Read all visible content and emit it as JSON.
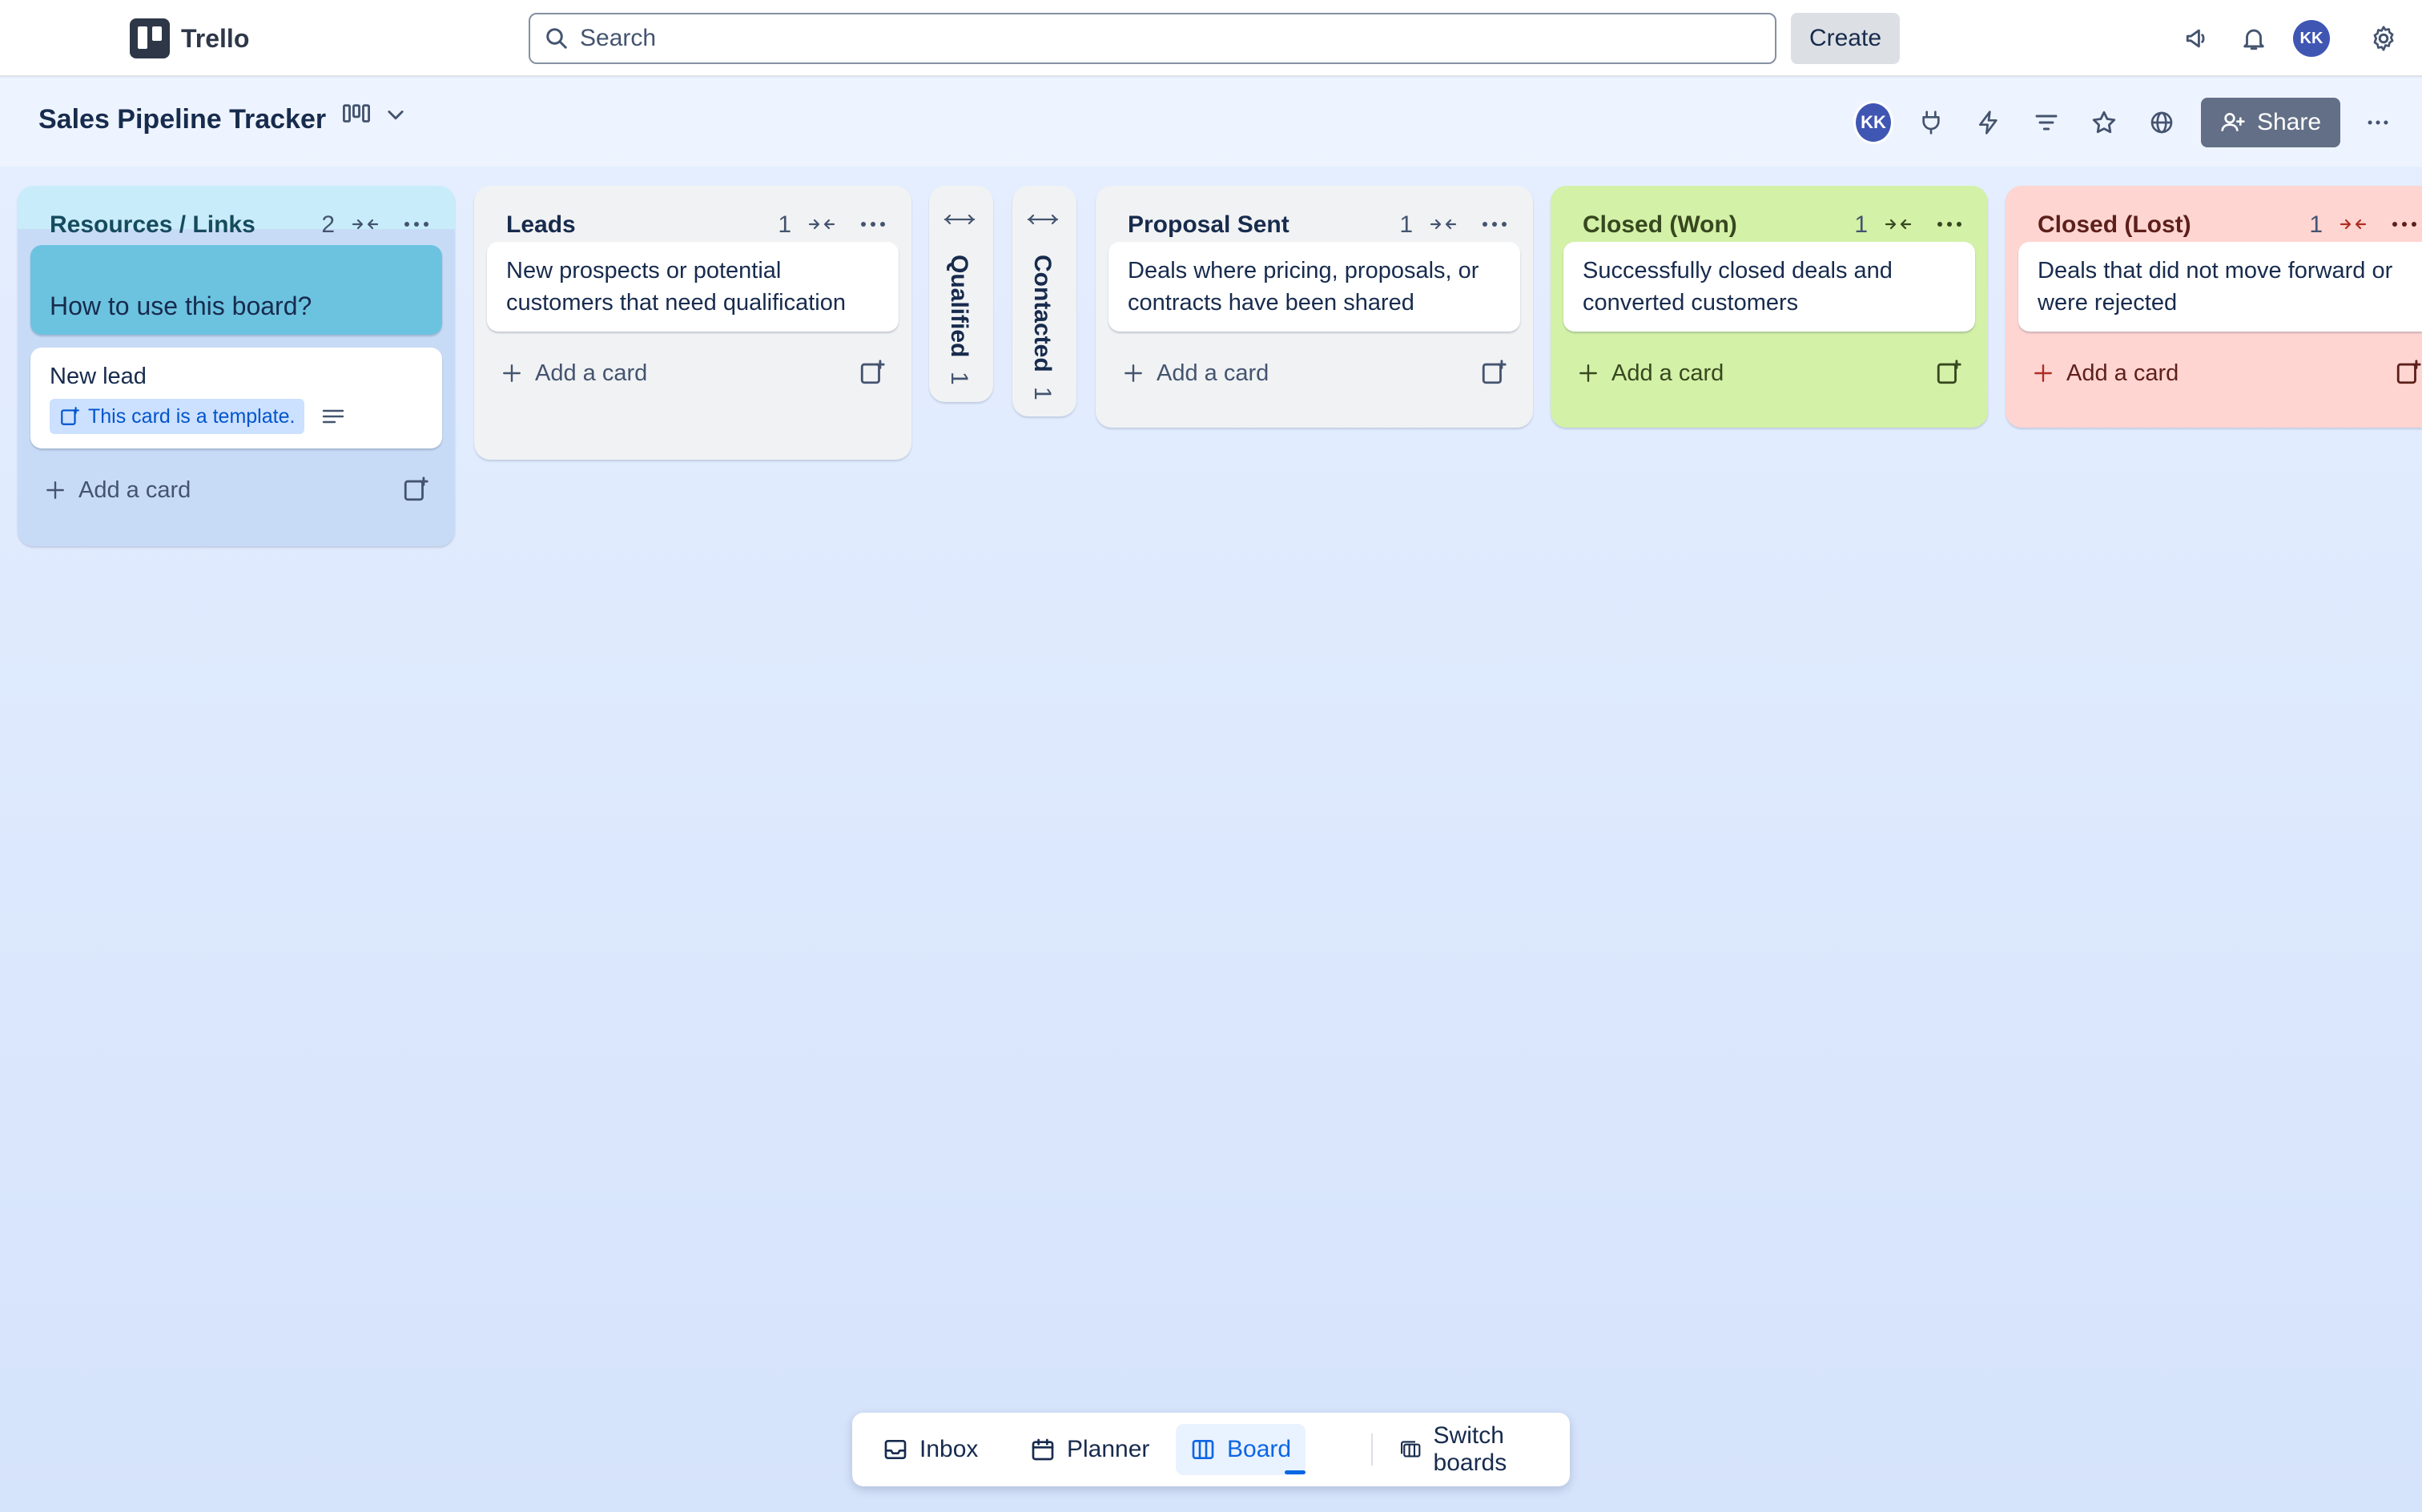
{
  "app": {
    "name": "Trello"
  },
  "topbar": {
    "search_placeholder": "Search",
    "create_label": "Create",
    "avatar_initials": "KK"
  },
  "board": {
    "title": "Sales Pipeline Tracker",
    "member_initials": "KK",
    "share_label": "Share"
  },
  "lists": [
    {
      "title": "Resources / Links",
      "count": "2",
      "cover_card": "How to use this board?",
      "template_card": {
        "title": "New lead",
        "badge": "This card is a template."
      },
      "add_label": "Add a card"
    },
    {
      "title": "Leads",
      "count": "1",
      "card": "New prospects or potential customers that need qualification",
      "add_label": "Add a card"
    },
    {
      "title": "Proposal Sent",
      "count": "1",
      "card": "Deals where pricing, proposals, or contracts have been shared",
      "add_label": "Add a card"
    },
    {
      "title": "Closed (Won)",
      "count": "1",
      "card": "Successfully closed deals and converted customers",
      "add_label": "Add a card"
    },
    {
      "title": "Closed (Lost)",
      "count": "1",
      "card": "Deals that did not move forward or were rejected",
      "add_label": "Add a card"
    }
  ],
  "collapsed_lists": [
    {
      "title": "Qualified",
      "count": "1"
    },
    {
      "title": "Contacted",
      "count": "1"
    }
  ],
  "bottom_nav": {
    "inbox": "Inbox",
    "planner": "Planner",
    "board": "Board",
    "switch": "Switch boards"
  },
  "colors": {
    "resources_header": "#c9ecfa",
    "resources_cover": "#6cc3e0",
    "won": "#d3f1a7",
    "lost": "#ffd5d2",
    "brand_blue": "#0c66e4"
  }
}
